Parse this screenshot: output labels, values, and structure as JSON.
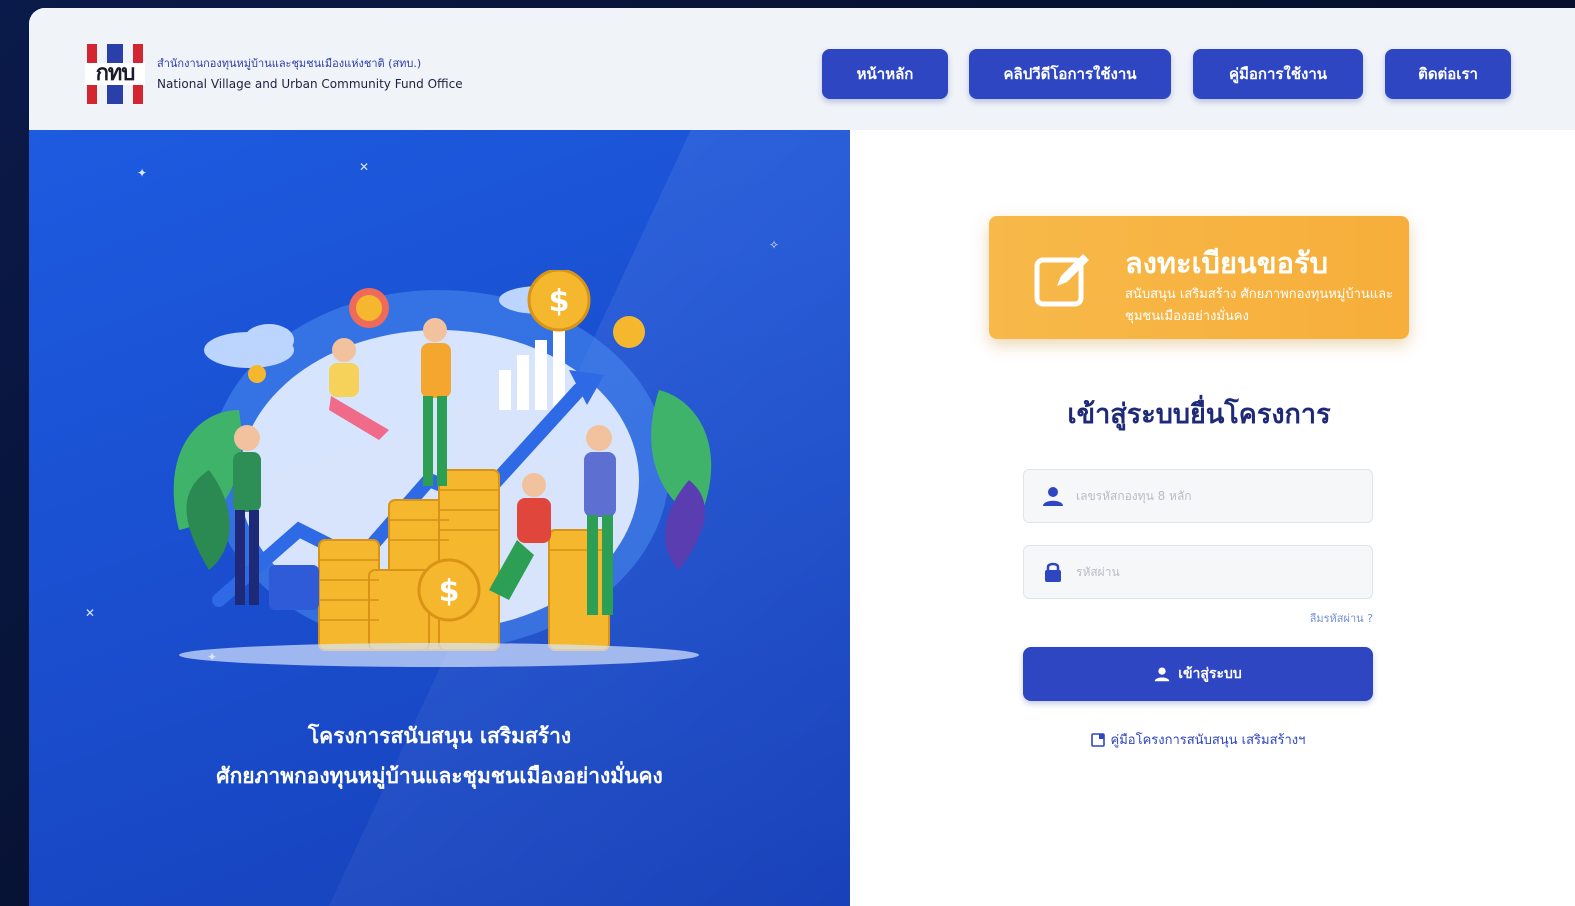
{
  "header": {
    "logo_text": "กทบ",
    "org_name_th": "สำนักงานกองทุนหมู่บ้านและชุมชนเมืองแห่งชาติ (สทบ.)",
    "org_name_en": "National Village and Urban Community Fund Office",
    "nav": [
      {
        "label": "หน้าหลัก"
      },
      {
        "label": "คลิปวีดีโอการใช้งาน"
      },
      {
        "label": "คู่มือการใช้งาน"
      },
      {
        "label": "ติดต่อเรา"
      }
    ]
  },
  "hero": {
    "caption_line1": "โครงการสนับสนุน เสริมสร้าง",
    "caption_line2": "ศักยภาพกองทุนหมู่บ้านและชุมชนเมืองอย่างมั่นคง"
  },
  "register": {
    "title": "ลงทะเบียนขอรับ",
    "subtitle": "สนับสนุน เสริมสร้าง ศักยภาพกองทุนหมู่บ้านและชุมชนเมืองอย่างมั่นคง"
  },
  "login": {
    "title": "เข้าสู่ระบบยื่นโครงการ",
    "username_placeholder": "เลขรหัสกองทุน 8 หลัก",
    "password_placeholder": "รหัสผ่าน",
    "forgot_label": "ลืมรหัสผ่าน ?",
    "submit_label": "เข้าสู่ระบบ",
    "manual_link": "คู่มือโครงการสนับสนุน เสริมสร้างฯ"
  },
  "colors": {
    "primary": "#2e46c2",
    "accent_orange": "#f7b23f",
    "hero_blue": "#1a4fd0",
    "title_navy": "#1e2a78"
  }
}
